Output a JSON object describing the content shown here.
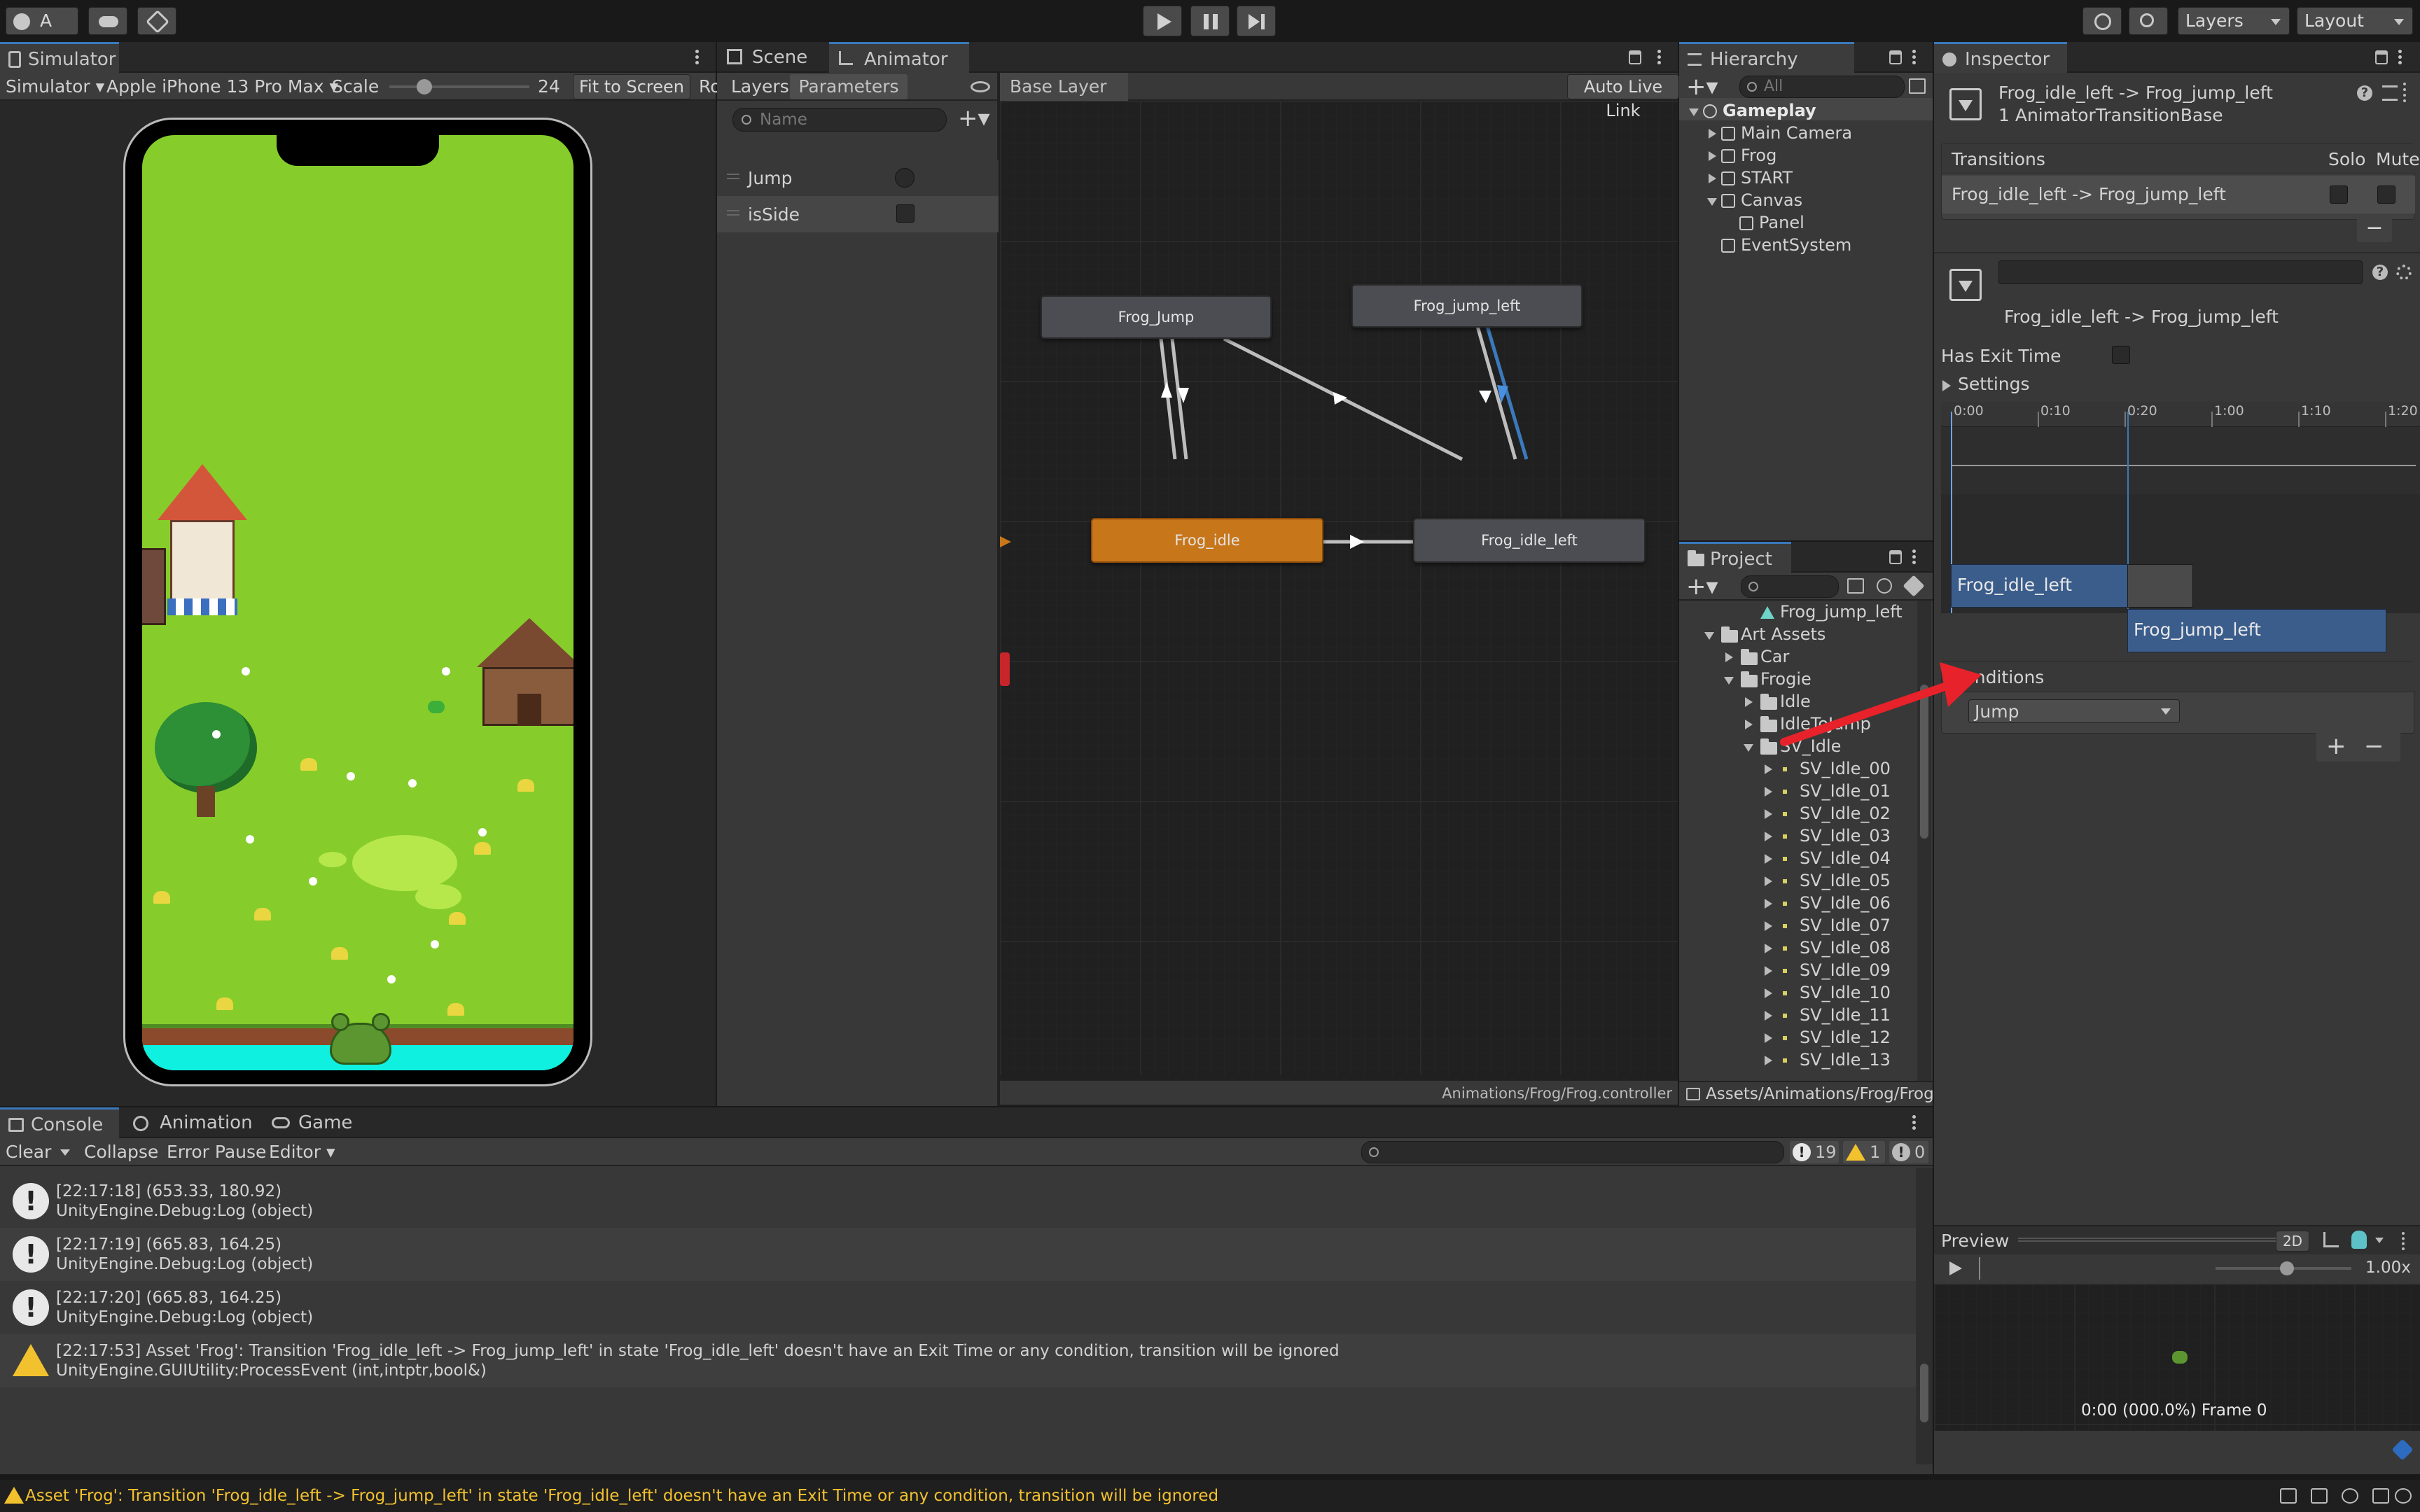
{
  "app": {
    "account": "A",
    "playback": [
      "play",
      "pause",
      "step"
    ],
    "layers_dropdown": "Layers",
    "layout_dropdown": "Layout"
  },
  "simulator": {
    "tab": "Simulator",
    "mode": "Simulator",
    "device": "Apple iPhone 13 Pro Max",
    "scale_label": "Scale",
    "scale_value": "24",
    "scale_slider_fraction": 0.25,
    "fit_button": "Fit to Screen",
    "rotate_button": "Ro"
  },
  "animator": {
    "tabs": [
      "Scene",
      "Animator"
    ],
    "subtabs": [
      "Layers",
      "Parameters"
    ],
    "name_placeholder": "Name",
    "breadcrumb": "Base Layer",
    "auto_live_link": "Auto Live Link",
    "params": [
      {
        "name": "Jump",
        "type": "trigger"
      },
      {
        "name": "isSide",
        "type": "bool"
      }
    ],
    "nodes": [
      {
        "name": "Frog_Jump",
        "active": false
      },
      {
        "name": "Frog_jump_left",
        "active": false
      },
      {
        "name": "Frog_idle",
        "active": true
      },
      {
        "name": "Frog_idle_left",
        "active": false
      }
    ],
    "footer_path": "Animations/Frog/Frog.controller"
  },
  "hierarchy": {
    "tab": "Hierarchy",
    "search_placeholder": "All",
    "items": [
      {
        "label": "Gameplay",
        "depth": 0,
        "bold": true
      },
      {
        "label": "Main Camera",
        "depth": 1
      },
      {
        "label": "Frog",
        "depth": 1
      },
      {
        "label": "START",
        "depth": 1
      },
      {
        "label": "Canvas",
        "depth": 1
      },
      {
        "label": "Panel",
        "depth": 2
      },
      {
        "label": "EventSystem",
        "depth": 1
      }
    ]
  },
  "project": {
    "tab": "Project",
    "footer_path": "Assets/Animations/Frog/Frog",
    "items": [
      {
        "label": "Frog_jump_left",
        "kind": "anim",
        "depth": 2
      },
      {
        "label": "Art Assets",
        "kind": "folder",
        "depth": 0
      },
      {
        "label": "Car",
        "kind": "folder",
        "depth": 1
      },
      {
        "label": "Frogie",
        "kind": "folder",
        "depth": 1
      },
      {
        "label": "Idle",
        "kind": "folder",
        "depth": 2
      },
      {
        "label": "IdleToJump",
        "kind": "folder",
        "depth": 2
      },
      {
        "label": "SV_Idle",
        "kind": "folder",
        "depth": 2
      },
      {
        "label": "SV_Idle_00",
        "kind": "sprite",
        "depth": 3
      },
      {
        "label": "SV_Idle_01",
        "kind": "sprite",
        "depth": 3
      },
      {
        "label": "SV_Idle_02",
        "kind": "sprite",
        "depth": 3
      },
      {
        "label": "SV_Idle_03",
        "kind": "sprite",
        "depth": 3
      },
      {
        "label": "SV_Idle_04",
        "kind": "sprite",
        "depth": 3
      },
      {
        "label": "SV_Idle_05",
        "kind": "sprite",
        "depth": 3
      },
      {
        "label": "SV_Idle_06",
        "kind": "sprite",
        "depth": 3
      },
      {
        "label": "SV_Idle_07",
        "kind": "sprite",
        "depth": 3
      },
      {
        "label": "SV_Idle_08",
        "kind": "sprite",
        "depth": 3
      },
      {
        "label": "SV_Idle_09",
        "kind": "sprite",
        "depth": 3
      },
      {
        "label": "SV_Idle_10",
        "kind": "sprite",
        "depth": 3
      },
      {
        "label": "SV_Idle_11",
        "kind": "sprite",
        "depth": 3
      },
      {
        "label": "SV_Idle_12",
        "kind": "sprite",
        "depth": 3
      },
      {
        "label": "SV_Idle_13",
        "kind": "sprite",
        "depth": 3
      }
    ]
  },
  "inspector": {
    "tab": "Inspector",
    "title": "Frog_idle_left -> Frog_jump_left",
    "subtitle": "1 AnimatorTransitionBase",
    "transitions_header": "Transitions",
    "solo": "Solo",
    "mute": "Mute",
    "transition_row": "Frog_idle_left -> Frog_jump_left",
    "transition_title": "Frog_idle_left -> Frog_jump_left",
    "has_exit_time": "Has Exit Time",
    "settings": "Settings",
    "timeline_ticks": [
      "0:00",
      "0:10",
      "0:20",
      "1:00",
      "1:10",
      "1:20"
    ],
    "clip_a": "Frog_idle_left",
    "clip_b": "Frog_jump_left",
    "conditions": "Conditions",
    "condition_param": "Jump"
  },
  "preview": {
    "label": "Preview",
    "mode_2d": "2D",
    "speed": "1.00x",
    "time": "0:00 (000.0%) Frame 0"
  },
  "console": {
    "tabs": [
      "Console",
      "Animation",
      "Game"
    ],
    "clear": "Clear",
    "collapse": "Collapse",
    "error_pause": "Error Pause",
    "editor": "Editor",
    "log_count": "19",
    "warn_count": "1",
    "error_count": "0",
    "entries": [
      {
        "kind": "log",
        "line1": "[22:17:18] (653.33, 180.92)",
        "line2": "UnityEngine.Debug:Log (object)"
      },
      {
        "kind": "log",
        "line1": "[22:17:19] (665.83, 164.25)",
        "line2": "UnityEngine.Debug:Log (object)"
      },
      {
        "kind": "log",
        "line1": "[22:17:20] (665.83, 164.25)",
        "line2": "UnityEngine.Debug:Log (object)"
      },
      {
        "kind": "warning",
        "line1": "[22:17:53] Asset 'Frog': Transition 'Frog_idle_left -> Frog_jump_left' in state 'Frog_idle_left' doesn't have an Exit Time or any condition, transition will be ignored",
        "line2": "UnityEngine.GUIUtility:ProcessEvent (int,intptr,bool&)"
      }
    ]
  },
  "statusbar": {
    "message": "Asset 'Frog': Transition 'Frog_idle_left -> Frog_jump_left' in state 'Frog_idle_left' doesn't have an Exit Time or any condition, transition will be ignored"
  },
  "colors": {
    "accent": "#3a79bb",
    "warning": "#f2c12e",
    "active_node": "#c8761a",
    "annotation_arrow": "#e8222a"
  }
}
